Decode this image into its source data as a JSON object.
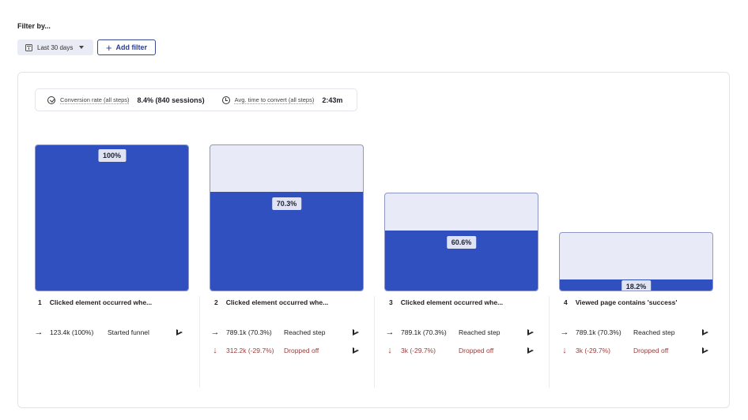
{
  "filters": {
    "heading": "Filter by...",
    "date_range": {
      "label": "Last 30 days",
      "icon": "calendar-icon"
    },
    "add_filter": {
      "label": "Add filter",
      "icon": "plus-icon"
    }
  },
  "summary": {
    "conversion": {
      "icon": "check-circle-icon",
      "label": "Conversion rate (all steps)",
      "value": "8.4% (840 sessions)"
    },
    "time_to_convert": {
      "icon": "clock-icon",
      "label": "Avg. time to convert (all steps)",
      "value": "2:43m"
    }
  },
  "colors": {
    "bar_fill": "#3050bf",
    "bar_track": "#e8ebf7",
    "dropped": "#9b3b3b",
    "accent": "#2d3b8f"
  },
  "steps": [
    {
      "number": "1",
      "title": "Clicked element occurred whe...",
      "percent_label": "100%",
      "bar_outer_fraction": 1.0,
      "bar_fill_fraction": 1.0,
      "reached": {
        "count": "123.4k (100%)",
        "label": "Started funnel"
      },
      "dropped": null
    },
    {
      "number": "2",
      "title": "Clicked element occurred whe...",
      "percent_label": "70.3%",
      "bar_outer_fraction": 1.0,
      "bar_fill_fraction": 0.672,
      "reached": {
        "count": "789.1k (70.3%)",
        "label": "Reached step"
      },
      "dropped": {
        "count": "312.2k (-29.7%)",
        "label": "Dropped off"
      }
    },
    {
      "number": "3",
      "title": "Clicked element occurred whe...",
      "percent_label": "60.6%",
      "bar_outer_fraction": 0.672,
      "bar_fill_fraction": 0.409,
      "reached": {
        "count": "789.1k (70.3%)",
        "label": "Reached step"
      },
      "dropped": {
        "count": "3k (-29.7%)",
        "label": "Dropped off"
      }
    },
    {
      "number": "4",
      "title": "Viewed page contains 'success'",
      "percent_label": "18.2%",
      "bar_outer_fraction": 0.403,
      "bar_fill_fraction": 0.075,
      "reached": {
        "count": "789.1k (70.3%)",
        "label": "Reached step"
      },
      "dropped": {
        "count": "3k (-29.7%)",
        "label": "Dropped off"
      }
    }
  ]
}
